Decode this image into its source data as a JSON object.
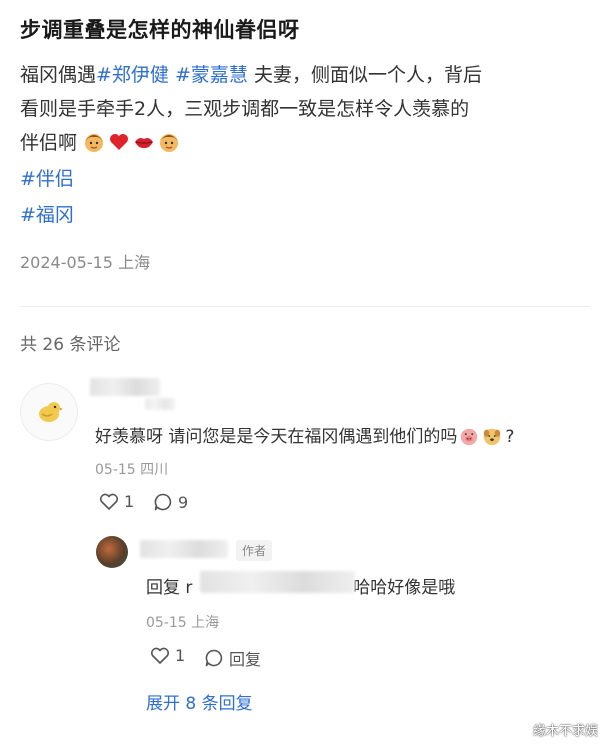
{
  "post": {
    "title": "步调重叠是怎样的神仙眷侣呀",
    "line1_prefix": "福冈偶遇",
    "topic1": "#郑伊健",
    "topic2": "#蒙嘉慧",
    "line1_suffix": " 夫妻，侧面似一个人，背后",
    "line2": "看则是手牵手2人，三观步调都一致是怎样令人羡慕的",
    "line3": "伴侣啊",
    "emojis": [
      "boy-face",
      "red-heart",
      "lips",
      "boy-face"
    ],
    "tag1": "#伴侣",
    "tag2": "#福冈",
    "date_location": "2024-05-15 上海"
  },
  "comments_header": "共 26 条评论",
  "comment1": {
    "text": "好羡慕呀 请问您是是今天在福冈偶遇到他们的吗",
    "suffix": "?",
    "meta": "05-15 四川",
    "likes": "1",
    "replies": "9"
  },
  "reply1": {
    "author_badge": "作者",
    "prefix": "回复 r",
    "text": "哈哈好像是哦",
    "meta": "05-15 上海",
    "likes": "1",
    "reply_label": "回复"
  },
  "expand_label": "展开 8 条回复",
  "watermark": "缘木不求娱",
  "colors": {
    "link": "#2f6fd3",
    "meta": "#999999"
  }
}
